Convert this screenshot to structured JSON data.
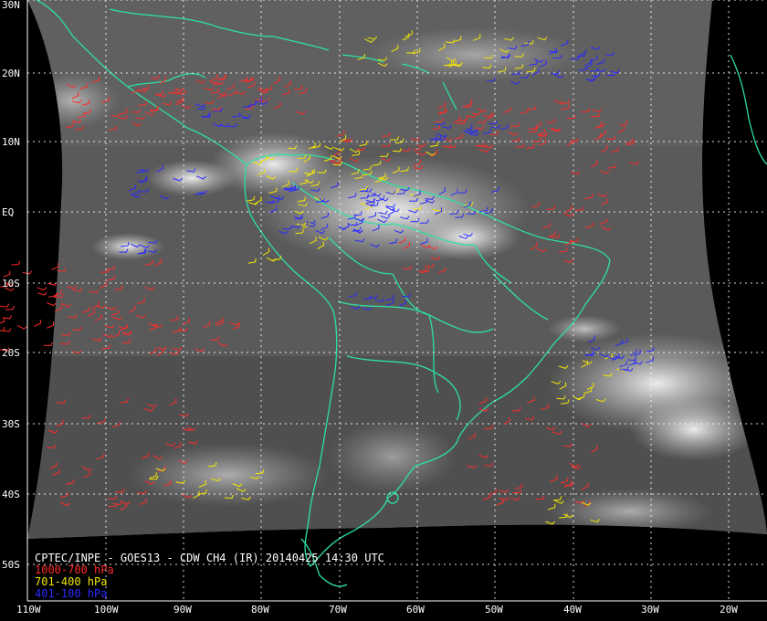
{
  "title": "CPTEC/INPE - GOES13 - CDW CH4 (IR) 20140425 14:30 UTC",
  "legend": [
    {
      "label": "1000-700 hPa",
      "color": "#ff2a2a"
    },
    {
      "label": "701-400 hPa",
      "color": "#f2e600"
    },
    {
      "label": "401-100 hPa",
      "color": "#2a2aff"
    }
  ],
  "lat_labels": [
    "30N",
    "20N",
    "10N",
    "EQ",
    "10S",
    "20S",
    "30S",
    "40S",
    "50S"
  ],
  "lon_labels": [
    "110W",
    "100W",
    "90W",
    "80W",
    "70W",
    "60W",
    "50W",
    "40W",
    "30W",
    "20W"
  ],
  "colors": {
    "coast": "#2de0a0",
    "grid": "#ffffff",
    "background": "#000000",
    "imagery": "#5a5a5a"
  }
}
